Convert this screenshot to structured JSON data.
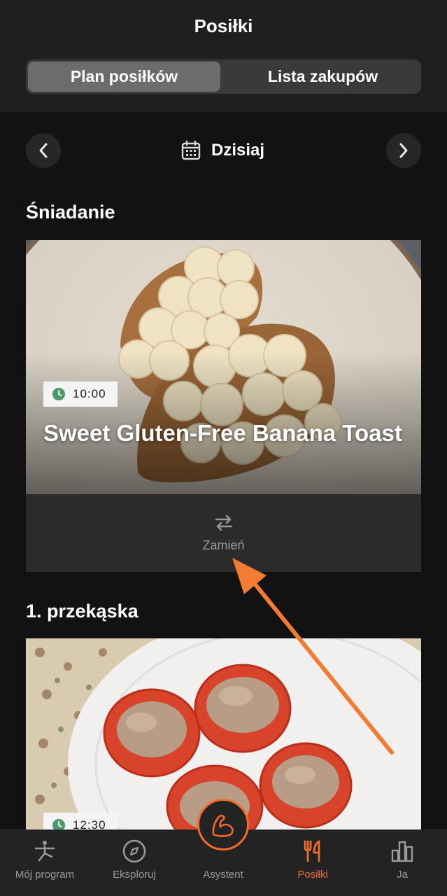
{
  "header": {
    "title": "Posiłki",
    "tabs": [
      {
        "label": "Plan posiłków",
        "active": true
      },
      {
        "label": "Lista zakupów",
        "active": false
      }
    ]
  },
  "date_nav": {
    "label": "Dzisiaj",
    "prev_icon": "chevron-left-icon",
    "next_icon": "chevron-right-icon",
    "calendar_icon": "calendar-icon"
  },
  "meals": [
    {
      "section": "Śniadanie",
      "time": "10:00",
      "title": "Sweet Gluten-Free Banana Toast",
      "swap_label": "Zamień"
    },
    {
      "section": "1. przekąska",
      "time": "12:30"
    }
  ],
  "tabbar": {
    "items": [
      {
        "label": "Mój program",
        "icon": "yoga-person-icon",
        "active": false
      },
      {
        "label": "Eksploruj",
        "icon": "compass-icon",
        "active": false
      },
      {
        "label": "Asystent",
        "icon": "flexed-arm-icon",
        "active": false
      },
      {
        "label": "Posiłki",
        "icon": "fork-knife-icon",
        "active": true
      },
      {
        "label": "Ja",
        "icon": "bar-chart-icon",
        "active": false
      }
    ]
  },
  "colors": {
    "accent": "#f26b2d",
    "background": "#121212",
    "surface": "#1f1f1f",
    "badge_clock": "#4a9a6a"
  }
}
